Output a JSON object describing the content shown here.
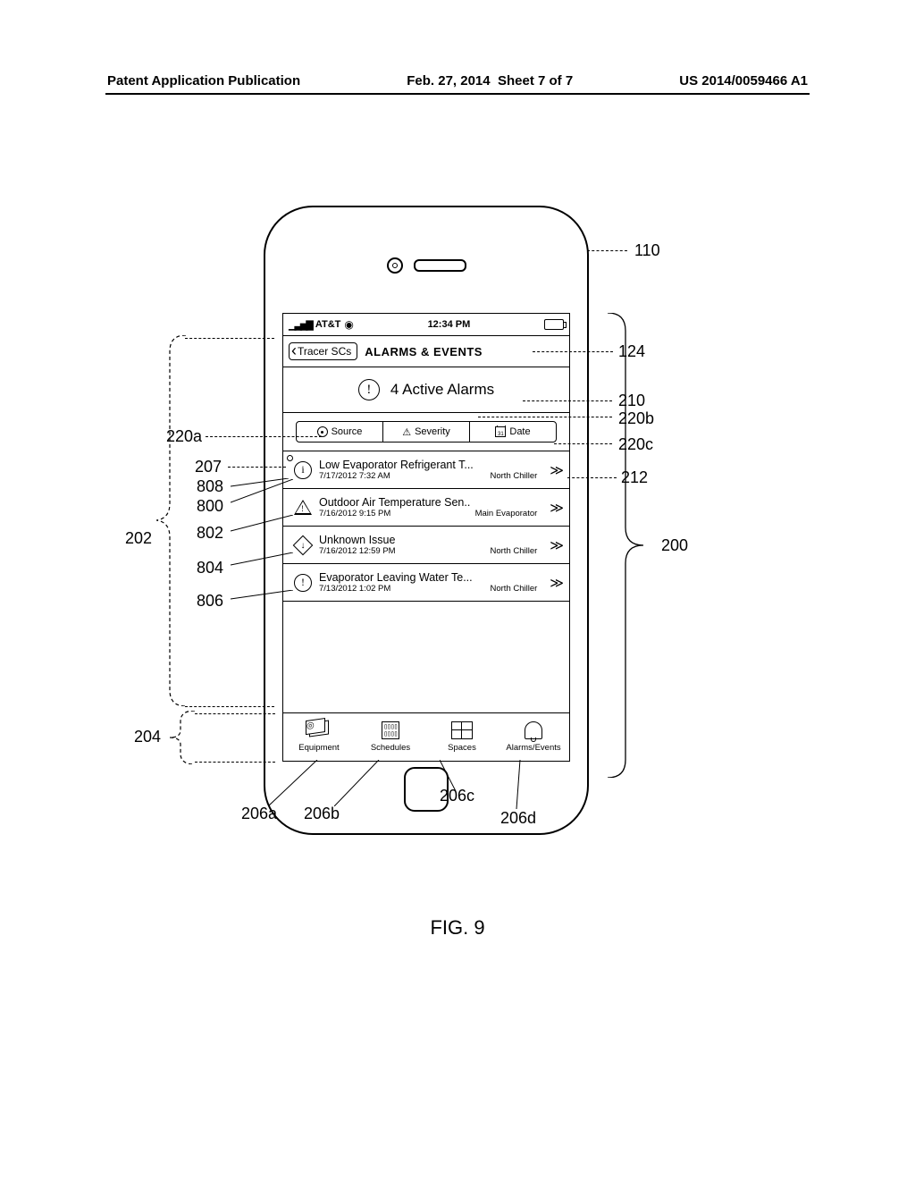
{
  "header": {
    "publication": "Patent Application Publication",
    "date": "Feb. 27, 2014",
    "sheet": "Sheet 7 of 7",
    "pubno": "US 2014/0059466 A1"
  },
  "figure_caption": "FIG. 9",
  "statusbar": {
    "carrier": "AT&T",
    "time": "12:34 PM"
  },
  "nav": {
    "back": "Tracer SCs",
    "title": "ALARMS & EVENTS"
  },
  "banner": "4 Active Alarms",
  "segments": {
    "source": "Source",
    "severity": "Severity",
    "date": "Date"
  },
  "alarms": [
    {
      "title": "Low Evaporator Refrigerant T...",
      "time": "7/17/2012 7:32 AM",
      "loc": "North Chiller",
      "icon": "circle-i",
      "unread": true
    },
    {
      "title": "Outdoor Air Temperature Sen..",
      "time": "7/16/2012 9:15 PM",
      "loc": "Main Evaporator",
      "icon": "triangle"
    },
    {
      "title": "Unknown Issue",
      "time": "7/16/2012 12:59 PM",
      "loc": "North Chiller",
      "icon": "diamond"
    },
    {
      "title": "Evaporator Leaving Water Te...",
      "time": "7/13/2012 1:02 PM",
      "loc": "North Chiller",
      "icon": "circle-ex"
    }
  ],
  "tabs": {
    "equipment": "Equipment",
    "schedules": "Schedules",
    "spaces": "Spaces",
    "alarms": "Alarms/Events"
  },
  "callouts": {
    "110": "110",
    "124": "124",
    "210": "210",
    "220a": "220a",
    "220b": "220b",
    "220c": "220c",
    "207": "207",
    "808": "808",
    "800": "800",
    "802": "802",
    "804": "804",
    "806": "806",
    "212": "212",
    "200": "200",
    "202": "202",
    "204": "204",
    "206a": "206a",
    "206b": "206b",
    "206c": "206c",
    "206d": "206d"
  }
}
